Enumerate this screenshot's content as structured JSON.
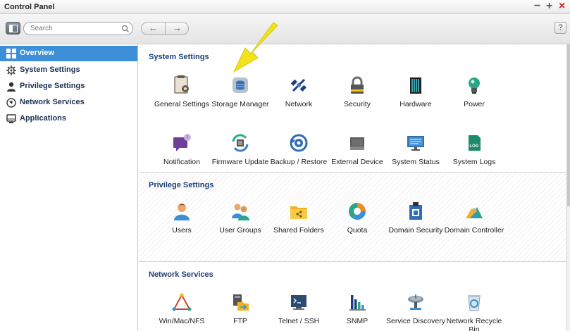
{
  "window": {
    "title": "Control Panel",
    "minimize": "−",
    "maximize": "+",
    "close": "×"
  },
  "toolbar": {
    "search_placeholder": "Search",
    "back": "←",
    "forward": "→",
    "help": "?"
  },
  "sidebar": {
    "items": [
      {
        "label": "Overview",
        "icon": "grid-icon",
        "active": true
      },
      {
        "label": "System Settings",
        "icon": "gear-icon",
        "active": false
      },
      {
        "label": "Privilege Settings",
        "icon": "user-icon",
        "active": false
      },
      {
        "label": "Network Services",
        "icon": "network-icon",
        "active": false
      },
      {
        "label": "Applications",
        "icon": "monitor-icon",
        "active": false
      }
    ]
  },
  "main": {
    "system": {
      "title": "System Settings",
      "items": [
        {
          "label": "General Settings",
          "icon": "general-settings-icon"
        },
        {
          "label": "Storage Manager",
          "icon": "storage-icon"
        },
        {
          "label": "Network",
          "icon": "network-satellite-icon"
        },
        {
          "label": "Security",
          "icon": "lock-icon"
        },
        {
          "label": "Hardware",
          "icon": "hardware-icon"
        },
        {
          "label": "Power",
          "icon": "bulb-icon"
        },
        {
          "label": "Notification",
          "icon": "notification-icon"
        },
        {
          "label": "Firmware Update",
          "icon": "firmware-icon"
        },
        {
          "label": "Backup / Restore",
          "icon": "backup-icon"
        },
        {
          "label": "External Device",
          "icon": "external-device-icon"
        },
        {
          "label": "System Status",
          "icon": "system-status-icon"
        },
        {
          "label": "System Logs",
          "icon": "log-icon",
          "badge": "LOG"
        }
      ]
    },
    "privilege": {
      "title": "Privilege Settings",
      "items": [
        {
          "label": "Users",
          "icon": "user-icon"
        },
        {
          "label": "User Groups",
          "icon": "user-groups-icon"
        },
        {
          "label": "Shared Folders",
          "icon": "folder-icon"
        },
        {
          "label": "Quota",
          "icon": "quota-pie-icon"
        },
        {
          "label": "Domain Security",
          "icon": "domain-security-icon"
        },
        {
          "label": "Domain Controller",
          "icon": "domain-controller-icon"
        }
      ]
    },
    "network": {
      "title": "Network Services",
      "items": [
        {
          "label": "Win/Mac/NFS",
          "icon": "triangle-network-icon"
        },
        {
          "label": "FTP",
          "icon": "ftp-icon"
        },
        {
          "label": "Telnet / SSH",
          "icon": "terminal-icon"
        },
        {
          "label": "SNMP",
          "icon": "bar-chart-icon"
        },
        {
          "label": "Service Discovery",
          "icon": "satellite-dish-icon"
        },
        {
          "label": "Network Recycle Bin",
          "icon": "recycle-bin-icon"
        }
      ]
    }
  },
  "colors": {
    "accent": "#3d8fd8",
    "section_title": "#1e3d7a",
    "annotation_arrow": "#f2e21c"
  }
}
